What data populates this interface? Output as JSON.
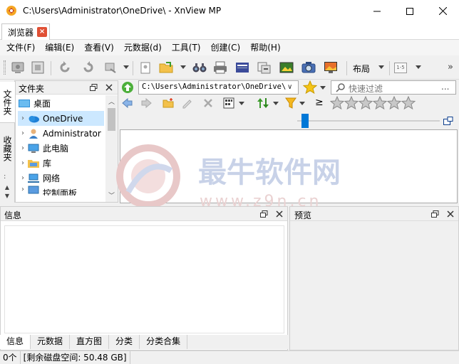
{
  "window": {
    "title": "C:\\Users\\Administrator\\OneDrive\\ - XnView MP",
    "app_icon": "xnview-logo-icon"
  },
  "tabs": [
    {
      "label": "浏览器",
      "closable": true
    }
  ],
  "menu": [
    "文件(F)",
    "编辑(E)",
    "查看(V)",
    "元数据(d)",
    "工具(T)",
    "创建(C)",
    "帮助(H)"
  ],
  "toolbar": {
    "layout_label": "布局",
    "view_mode_label": "1-5"
  },
  "side_tabs": [
    "文件夹",
    "收藏夹"
  ],
  "folder_panel": {
    "title": "文件夹",
    "items": [
      {
        "label": "桌面",
        "icon": "desktop-icon",
        "expandable": false
      },
      {
        "label": "OneDrive",
        "icon": "onedrive-icon",
        "expandable": true,
        "selected": true
      },
      {
        "label": "Administrator",
        "icon": "user-folder-icon",
        "expandable": true
      },
      {
        "label": "此电脑",
        "icon": "computer-icon",
        "expandable": true
      },
      {
        "label": "库",
        "icon": "library-icon",
        "expandable": true
      },
      {
        "label": "网络",
        "icon": "network-icon",
        "expandable": true
      },
      {
        "label": "控制面板",
        "icon": "control-panel-icon",
        "expandable": true
      }
    ]
  },
  "address": {
    "path": "C:\\Users\\Administrator\\OneDrive\\"
  },
  "search": {
    "placeholder": "快速过滤",
    "more": "..."
  },
  "filter": {
    "operator": "≥",
    "rating_stars": 5
  },
  "info_panel": {
    "title": "信息",
    "tabs": [
      "信息",
      "元数据",
      "直方图",
      "分类",
      "分类合集"
    ],
    "active_tab": 0
  },
  "preview_panel": {
    "title": "预览"
  },
  "status": {
    "count": "0个",
    "disk_free": "[剩余磁盘空间: 50.48 GB]"
  },
  "watermark": {
    "title": "最牛软件网",
    "url": "www.z9n.cn"
  },
  "colors": {
    "accent": "#0078d7",
    "selection": "#cce8ff",
    "tab_close": "#e05035"
  }
}
